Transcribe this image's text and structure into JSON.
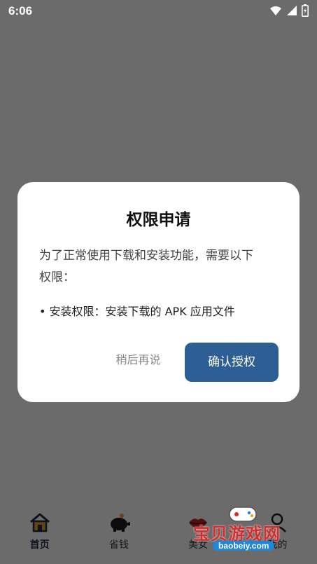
{
  "status_bar": {
    "time": "6:06"
  },
  "dialog": {
    "title": "权限申请",
    "body_line1": "为了正常使用下载和安装功能，需要以下",
    "body_line2": "权限：",
    "bullet": "• 安装权限：安装下载的 APK 应用文件",
    "later_button": "稍后再说",
    "confirm_button": "确认授权"
  },
  "bottom_nav": {
    "items": [
      {
        "label": "首页",
        "icon": "home-icon"
      },
      {
        "label": "省钱",
        "icon": "piggy-bank-icon"
      },
      {
        "label": "美女",
        "icon": "lips-icon"
      },
      {
        "label": "我的",
        "icon": "profile-icon"
      }
    ]
  },
  "watermark": {
    "title": "宝贝游戏网",
    "url": "baobeiy.com"
  },
  "colors": {
    "confirm_button": "#2d5f94",
    "overlay": "rgba(0,0,0,0.58)"
  }
}
